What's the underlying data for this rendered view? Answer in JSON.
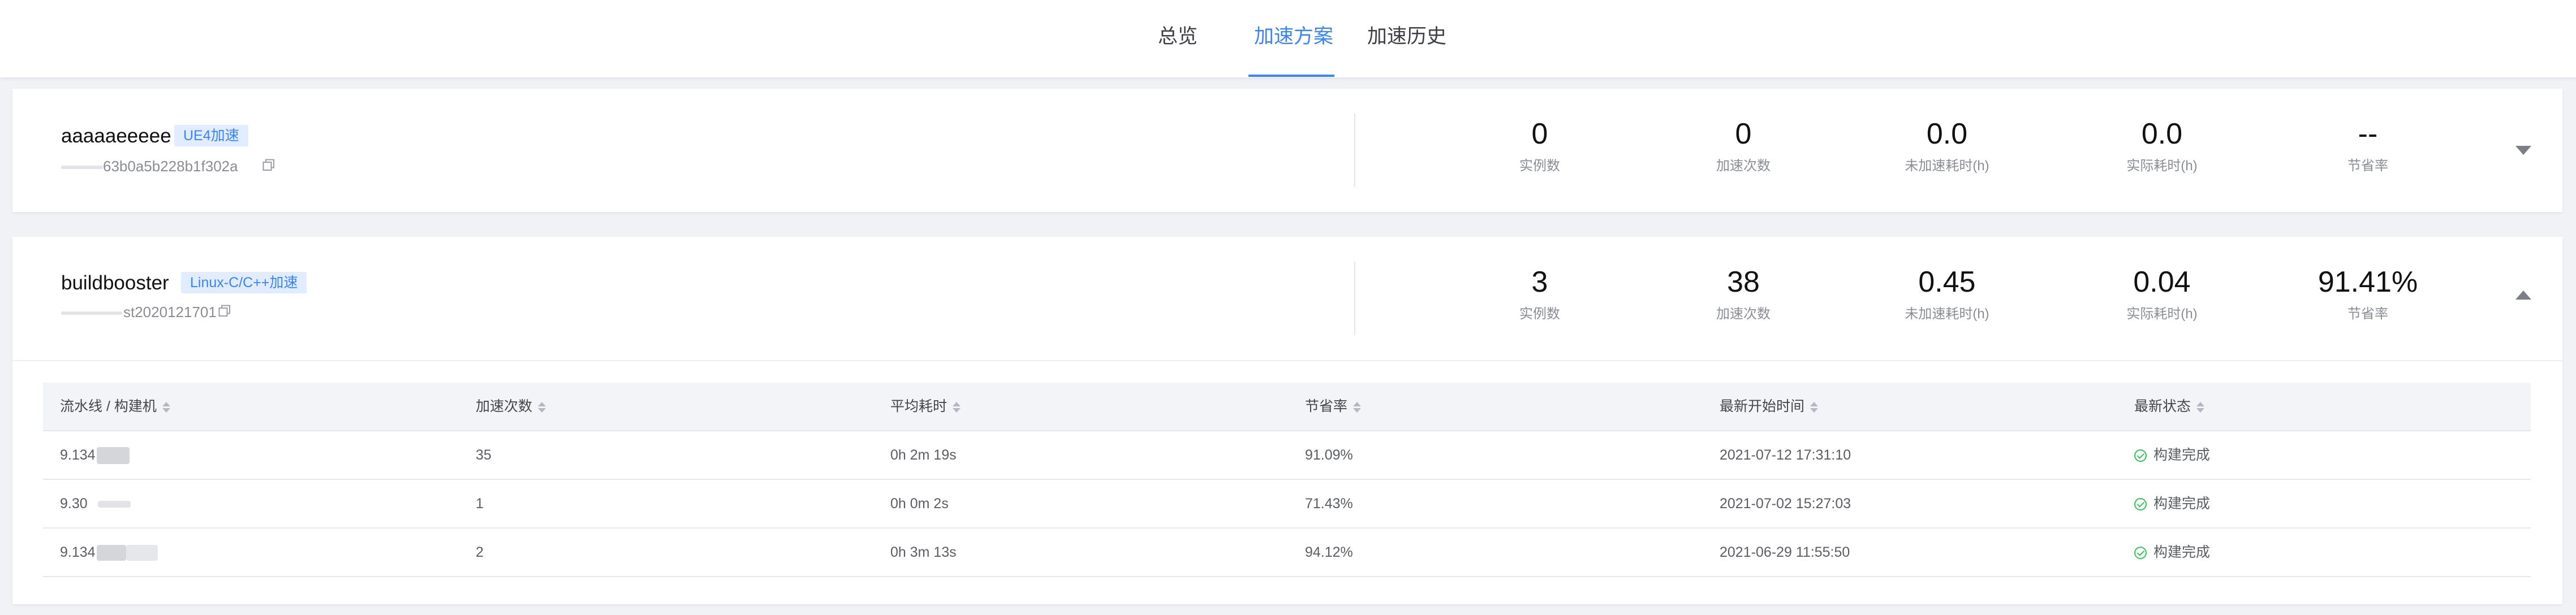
{
  "nav": {
    "tabs": [
      {
        "label": "总览",
        "active": false
      },
      {
        "label": "加速方案",
        "active": true
      },
      {
        "label": "加速历史",
        "active": false
      }
    ],
    "accent_color": "#3a84ff"
  },
  "plans": [
    {
      "name": "aaaaaeeeee",
      "badge": "UE4加速",
      "id_suffix": "63b0a5b228b1f302a",
      "expanded": false,
      "stats": [
        {
          "value": "0",
          "label": "实例数"
        },
        {
          "value": "0",
          "label": "加速次数"
        },
        {
          "value": "0.0",
          "label": "未加速耗时(h)"
        },
        {
          "value": "0.0",
          "label": "实际耗时(h)"
        },
        {
          "value": "--",
          "label": "节省率"
        }
      ]
    },
    {
      "name": "buildbooster",
      "badge": "Linux-C/C++加速",
      "id_suffix": "st2020121701",
      "expanded": true,
      "stats": [
        {
          "value": "3",
          "label": "实例数"
        },
        {
          "value": "38",
          "label": "加速次数"
        },
        {
          "value": "0.45",
          "label": "未加速耗时(h)"
        },
        {
          "value": "0.04",
          "label": "实际耗时(h)"
        },
        {
          "value": "91.41%",
          "label": "节省率"
        }
      ],
      "table": {
        "columns": [
          "流水线 / 构建机",
          "加速次数",
          "平均耗时",
          "节省率",
          "最新开始时间",
          "最新状态"
        ],
        "rows": [
          {
            "machine": "9.134",
            "count": "35",
            "avg_time": "0h 2m 19s",
            "rate": "91.09%",
            "start": "2021-07-12 17:31:10",
            "status": "构建完成"
          },
          {
            "machine": "9.30",
            "count": "1",
            "avg_time": "0h 0m 2s",
            "rate": "71.43%",
            "start": "2021-07-02 15:27:03",
            "status": "构建完成"
          },
          {
            "machine": "9.134",
            "count": "2",
            "avg_time": "0h 3m 13s",
            "rate": "94.12%",
            "start": "2021-06-29 11:55:50",
            "status": "构建完成"
          }
        ]
      }
    }
  ],
  "icons": {
    "copy": "copy-icon",
    "expand": "caret-down-icon",
    "collapse": "caret-up-icon",
    "status_ok": "check-circle-icon"
  },
  "status_color": "#2dcb56"
}
